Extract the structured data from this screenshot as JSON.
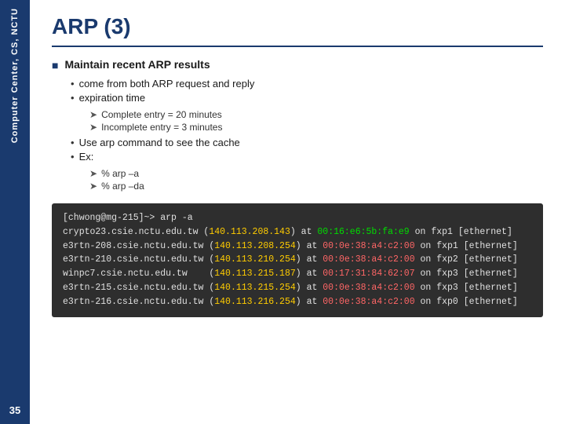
{
  "sidebar": {
    "label1": "Computer",
    "label2": "Center,",
    "label3": "CS, NCTU",
    "page_number": "35"
  },
  "header": {
    "title": "ARP (3)"
  },
  "main_bullet": {
    "label": "Maintain recent ARP results"
  },
  "sub_bullets": [
    {
      "text": "come from both ARP request and reply"
    },
    {
      "text": "expiration time"
    }
  ],
  "arrow_bullets_expiration": [
    {
      "text": "Complete entry = 20 minutes"
    },
    {
      "text": "Incomplete entry = 3 minutes"
    }
  ],
  "sub_bullets2": [
    {
      "text": "Use arp command to see the cache"
    },
    {
      "text": "Ex:"
    }
  ],
  "arrow_bullets_ex": [
    {
      "text": "% arp –a"
    },
    {
      "text": "% arp –da"
    }
  ],
  "terminal": {
    "lines": [
      {
        "parts": [
          {
            "text": "[chwong@mg-215]~> arp -a",
            "color": "plain"
          }
        ]
      },
      {
        "parts": [
          {
            "text": "crypto23.csie.nctu.edu.tw (",
            "color": "plain"
          },
          {
            "text": "140.113.208.143",
            "color": "ip"
          },
          {
            "text": ") at ",
            "color": "plain"
          },
          {
            "text": "00:16:e6:5b:fa:e9",
            "color": "mac-green"
          },
          {
            "text": " on fxp1 [ethernet]",
            "color": "plain"
          }
        ]
      },
      {
        "parts": [
          {
            "text": "e3rtn-208.csie.nctu.edu.tw (",
            "color": "plain"
          },
          {
            "text": "140.113.208.254",
            "color": "ip"
          },
          {
            "text": ") at ",
            "color": "plain"
          },
          {
            "text": "00:0e:38:a4:c2:00",
            "color": "mac-red"
          },
          {
            "text": " on fxp1 [ethernet]",
            "color": "plain"
          }
        ]
      },
      {
        "parts": [
          {
            "text": "e3rtn-210.csie.nctu.edu.tw (",
            "color": "plain"
          },
          {
            "text": "140.113.210.254",
            "color": "ip"
          },
          {
            "text": ") at ",
            "color": "plain"
          },
          {
            "text": "00:0e:38:a4:c2:00",
            "color": "mac-red"
          },
          {
            "text": " on fxp2 [ethernet]",
            "color": "plain"
          }
        ]
      },
      {
        "parts": [
          {
            "text": "winpc7.csie.nctu.edu.tw    (",
            "color": "plain"
          },
          {
            "text": "140.113.215.187",
            "color": "ip"
          },
          {
            "text": ") at ",
            "color": "plain"
          },
          {
            "text": "00:17:31:84:62:07",
            "color": "mac-red"
          },
          {
            "text": " on fxp3 [ethernet]",
            "color": "plain"
          }
        ]
      },
      {
        "parts": [
          {
            "text": "e3rtn-215.csie.nctu.edu.tw (",
            "color": "plain"
          },
          {
            "text": "140.113.215.254",
            "color": "ip"
          },
          {
            "text": ") at ",
            "color": "plain"
          },
          {
            "text": "00:0e:38:a4:c2:00",
            "color": "mac-red"
          },
          {
            "text": " on fxp3 [ethernet]",
            "color": "plain"
          }
        ]
      },
      {
        "parts": [
          {
            "text": "e3rtn-216.csie.nctu.edu.tw (",
            "color": "plain"
          },
          {
            "text": "140.113.216.254",
            "color": "ip"
          },
          {
            "text": ") at ",
            "color": "plain"
          },
          {
            "text": "00:0e:38:a4:c2:00",
            "color": "mac-red"
          },
          {
            "text": " on fxp0 [ethernet]",
            "color": "plain"
          }
        ]
      }
    ]
  }
}
